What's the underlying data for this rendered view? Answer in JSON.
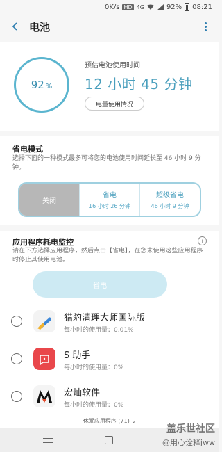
{
  "status_bar": {
    "speed": "0K/s",
    "hd": "HD",
    "net": "4G",
    "battery": "92%",
    "time": "08:21"
  },
  "header": {
    "title": "电池"
  },
  "summary": {
    "percent": "92",
    "percent_sign": "%",
    "estimate_label": "预估电池使用时间",
    "estimate_value": "12 小时 45 分钟",
    "usage_button": "电量使用情况"
  },
  "power_mode": {
    "title": "省电模式",
    "description": "选择下面的一种模式最多可将您的电池使用时间延长至 46 小时 9 分钟。",
    "options": [
      {
        "label": "关闭",
        "sub": ""
      },
      {
        "label": "省电",
        "sub": "16 小时 26 分钟"
      },
      {
        "label": "超级省电",
        "sub": "46 小时 9 分钟"
      }
    ]
  },
  "app_monitor": {
    "title": "应用程序耗电监控",
    "info_icon": "i",
    "description": "请在下方选择应用程序，然后点击【省电】，在您未使用这些应用程序时停止其使用电池。",
    "save_button": "省电",
    "apps": [
      {
        "name": "猎豹清理大师国际版",
        "usage": "每小时的使用量：0.01%"
      },
      {
        "name": "S 助手",
        "usage": "每小时的使用量：0%"
      },
      {
        "name": "宏灿软件",
        "usage": "每小时的使用量：0%"
      }
    ],
    "more_link": "休眠应用程序 (71) ⌄"
  },
  "watermark": {
    "line1": "盖乐世社区",
    "line2": "@用心诠释jww"
  }
}
